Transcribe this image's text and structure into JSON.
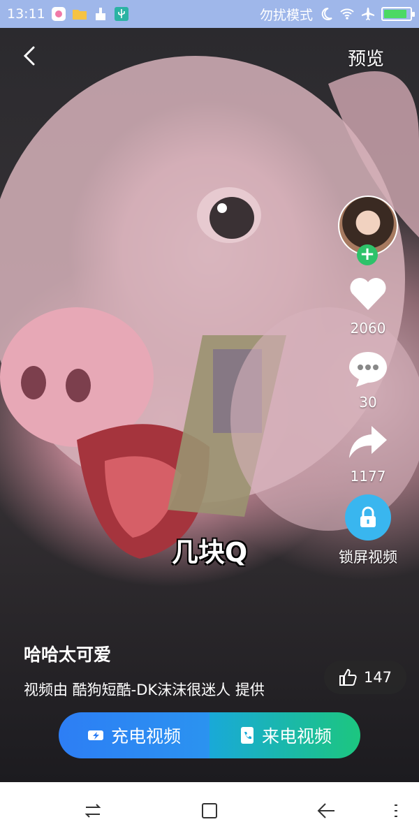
{
  "status_bar": {
    "time": "13:11",
    "dnd_label": "勿扰模式",
    "battery_level": 0.9
  },
  "top_bar": {
    "preview_label": "预览"
  },
  "actions": {
    "like_count": "2060",
    "comment_count": "30",
    "share_count": "1177",
    "lock_screen_label": "锁屏视频"
  },
  "video": {
    "caption_overlay": "几块Q",
    "title": "哈哈太可爱",
    "credit": "视频由 酷狗短酷-DK沫沫很迷人 提供",
    "thumbs_count": "147"
  },
  "buttons": {
    "charge_video": "充电视频",
    "call_video": "来电视频"
  },
  "colors": {
    "status_bar_bg": "#9fb7ea",
    "follow_green": "#2ec26a",
    "lock_blue": "#39b6ef",
    "charge_blue": "#2d7ef5",
    "call_green": "#1cc67f"
  }
}
